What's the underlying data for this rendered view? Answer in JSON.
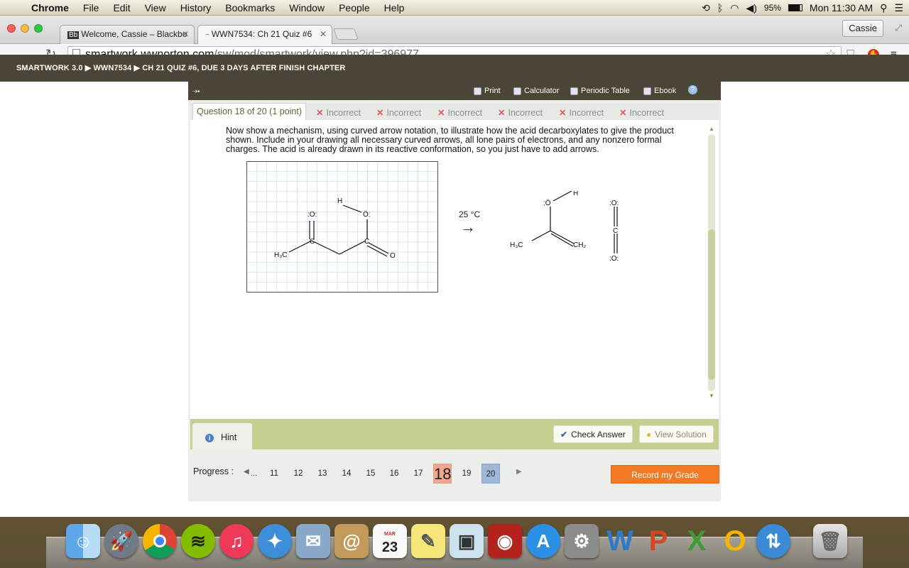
{
  "menubar": {
    "app": "Chrome",
    "items": [
      "File",
      "Edit",
      "View",
      "History",
      "Bookmarks",
      "Window",
      "People",
      "Help"
    ],
    "battery": "95%",
    "clock": "Mon 11:30 AM"
  },
  "browser": {
    "tabs": [
      {
        "favicon": "Bb",
        "title": "Welcome, Cassie – Blackbo"
      },
      {
        "favicon": "~",
        "title": "WWN7534: Ch 21 Quiz #6"
      }
    ],
    "user": "Cassie",
    "url_host": "smartwork.wwnorton.com",
    "url_path": "/sw/mod/smartwork/view.php?id=396977"
  },
  "breadcrumb": "SMARTWORK 3.0 ▶ WWN7534 ▶ CH 21 QUIZ #6, DUE 3 DAYS AFTER FINISH CHAPTER",
  "tools": {
    "print": "Print",
    "calculator": "Calculator",
    "periodic": "Periodic Table",
    "ebook": "Ebook",
    "help": "?"
  },
  "question": {
    "header": "Question 18 of 20 (1 point)",
    "attempts": [
      "Incorrect",
      "Incorrect",
      "Incorrect",
      "Incorrect",
      "Incorrect",
      "Incorrect"
    ],
    "text": "Now show a mechanism, using curved arrow notation, to illustrate how the acid decarboxylates to give the product shown. Include in your drawing all necessary curved arrows, all lone pairs of electrons, and any nonzero formal charges. The acid is already drawn in its reactive conformation, so you just have to add arrows.",
    "condition": "25 °C"
  },
  "molecules": {
    "reactant": {
      "o_top": ":O:",
      "o_oh": "Ö:",
      "h": "H",
      "c1": "C",
      "c2": "C",
      "o_bot": "O",
      "ch3": "H₃C"
    },
    "product": {
      "o": ":Ö",
      "h": "H",
      "ch3": "H₃C",
      "ch2": "CH₂",
      "co2_o_top": ":O:",
      "co2_c": "C",
      "co2_o_bot": ":O:"
    }
  },
  "actions": {
    "hint": "Hint",
    "check": "Check Answer",
    "solution": "View Solution",
    "record": "Record my Grade"
  },
  "progress": {
    "label": "Progress :",
    "ellipsis": "...",
    "pages": [
      "11",
      "12",
      "13",
      "14",
      "15",
      "16",
      "17",
      "18",
      "19",
      "20"
    ],
    "current": "18"
  },
  "dock": [
    "finder-icon",
    "launchpad-icon",
    "chrome-icon",
    "spotify-icon",
    "itunes-icon",
    "safari-icon",
    "mail-icon",
    "contacts-icon",
    "calendar-icon",
    "notes-icon",
    "preview-icon",
    "photobooth-icon",
    "appstore-icon",
    "system-preferences-icon",
    "word-icon",
    "powerpoint-icon",
    "excel-icon",
    "outlook-icon",
    "network-icon",
    "trash-icon"
  ],
  "calendar_day": "23",
  "calendar_month": "MAR"
}
